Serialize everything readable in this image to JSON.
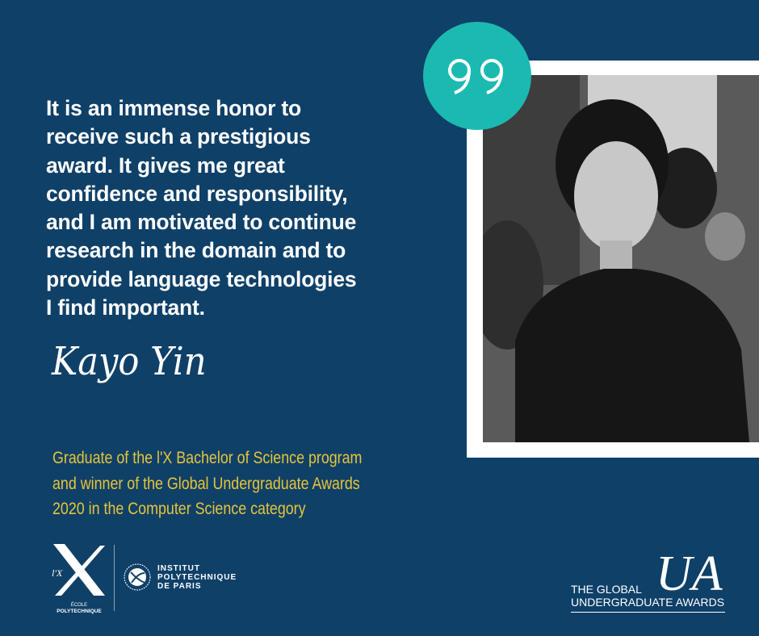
{
  "quote": {
    "lines": [
      "It is an immense honor to",
      "receive such a prestigious",
      "award. It gives me great",
      "confidence and responsibility,",
      "and I am motivated to continue",
      "research in the domain and to",
      "provide language technologies",
      "I find important."
    ],
    "icon": "quotation-mark-icon"
  },
  "signature": "Kayo Yin",
  "caption": {
    "lines": [
      "Graduate of the l'X Bachelor of Science program",
      "and winner of the Global Undergraduate Awards",
      "2020 in the Computer Science category"
    ]
  },
  "logos": {
    "ecole": {
      "mark": "l'X",
      "line1": "ÉCOLE",
      "line2": "POLYTECHNIQUE"
    },
    "ipp": {
      "line1": "INSTITUT",
      "line2": "POLYTECHNIQUE",
      "line3": "DE PARIS"
    },
    "gua": {
      "mark": "UA",
      "line1": "THE GLOBAL",
      "line2": "UNDERGRADUATE AWARDS"
    }
  },
  "colors": {
    "background": "#0f4068",
    "accent_teal": "#1cb9b1",
    "caption_yellow": "#e6c53a"
  }
}
